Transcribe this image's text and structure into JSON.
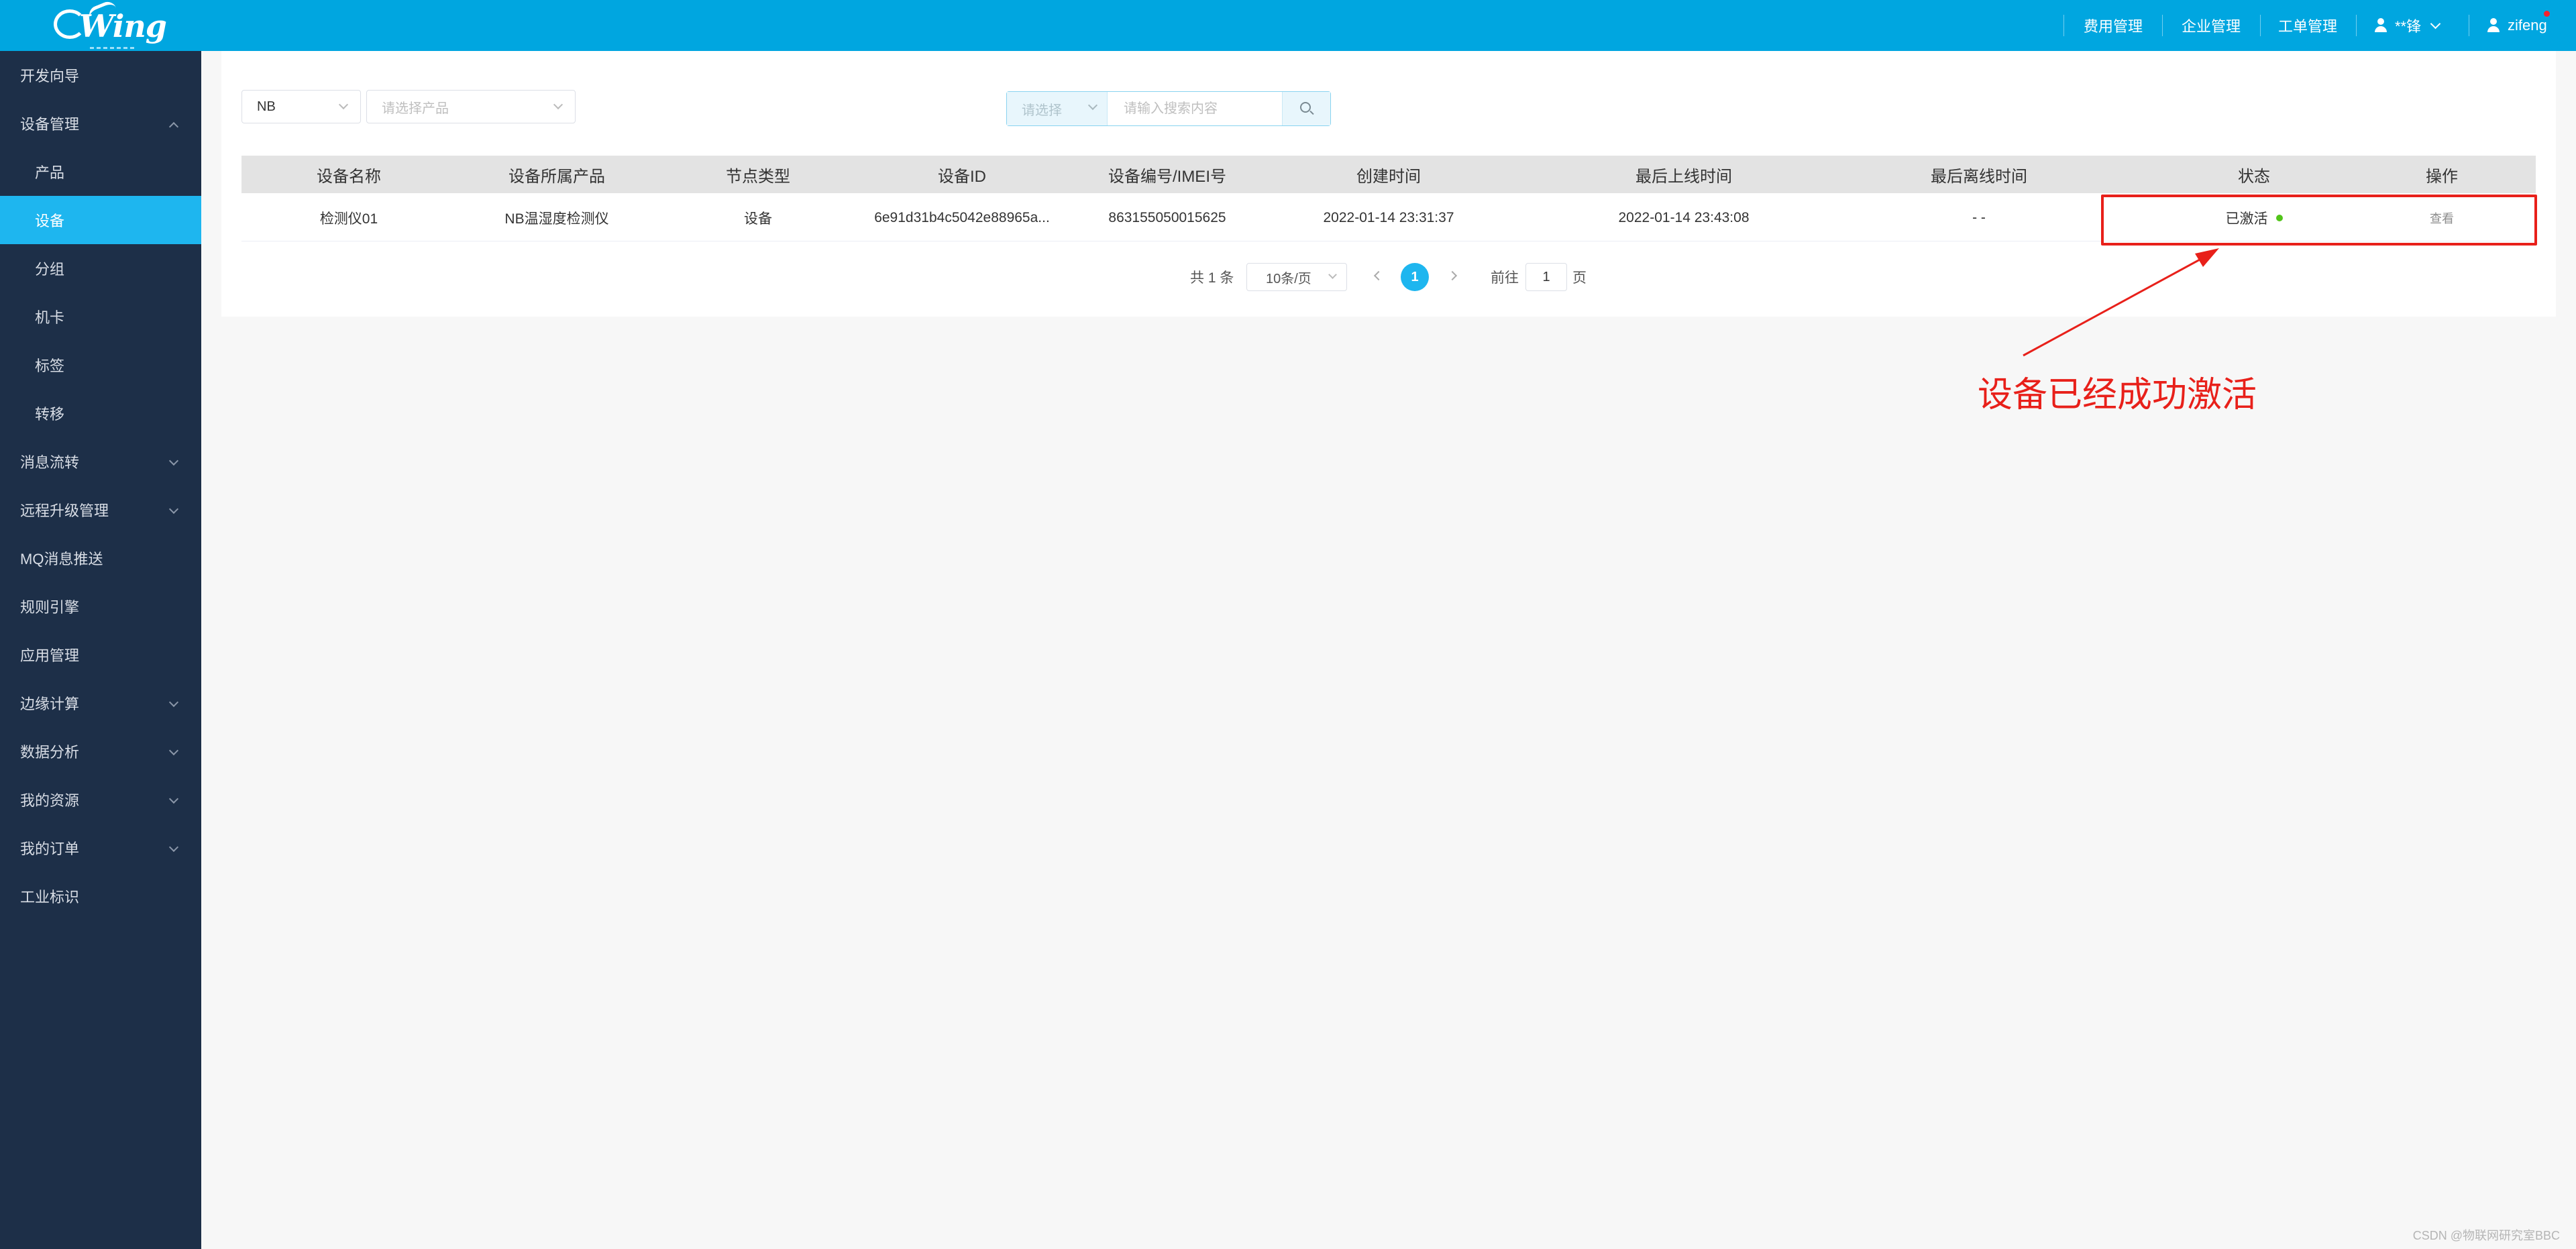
{
  "header": {
    "logo_text": "Wing",
    "nav": [
      "费用管理",
      "企业管理",
      "工单管理"
    ],
    "user1_name": "**锋",
    "user2_name": "zifeng"
  },
  "sidebar": {
    "items": [
      {
        "label": "开发向导"
      },
      {
        "label": "设备管理"
      },
      {
        "label": "产品"
      },
      {
        "label": "设备"
      },
      {
        "label": "分组"
      },
      {
        "label": "机卡"
      },
      {
        "label": "标签"
      },
      {
        "label": "转移"
      },
      {
        "label": "消息流转"
      },
      {
        "label": "远程升级管理"
      },
      {
        "label": "MQ消息推送"
      },
      {
        "label": "规则引擎"
      },
      {
        "label": "应用管理"
      },
      {
        "label": "边缘计算"
      },
      {
        "label": "数据分析"
      },
      {
        "label": "我的资源"
      },
      {
        "label": "我的订单"
      },
      {
        "label": "工业标识"
      }
    ]
  },
  "filters": {
    "type_value": "NB",
    "product_placeholder": "请选择产品",
    "search_select_placeholder": "请选择",
    "search_placeholder": "请输入搜索内容"
  },
  "table": {
    "headers": [
      "设备名称",
      "设备所属产品",
      "节点类型",
      "设备ID",
      "设备编号/IMEI号",
      "创建时间",
      "最后上线时间",
      "最后离线时间",
      "状态",
      "操作"
    ],
    "rows": [
      {
        "name": "检测仪01",
        "product": "NB温湿度检测仪",
        "node_type": "设备",
        "device_id": "6e91d31b4c5042e88965a...",
        "imei": "863155050015625",
        "created": "2022-01-14 23:31:37",
        "last_online": "2022-01-14 23:43:08",
        "last_offline": "- -",
        "status": "已激活",
        "action": "查看"
      }
    ]
  },
  "pagination": {
    "total": "共 1 条",
    "page_size": "10条/页",
    "current": "1",
    "goto_prefix": "前往",
    "goto_value": "1",
    "goto_suffix": "页"
  },
  "annotation": {
    "text": "设备已经成功激活",
    "color": "#e8201a"
  },
  "watermark": "CSDN @物联网研究室BBC",
  "colors": {
    "header": "#00a6e0",
    "sidebar": "#1d2f48",
    "active": "#1eb6ef",
    "status_ok": "#52c41a"
  }
}
